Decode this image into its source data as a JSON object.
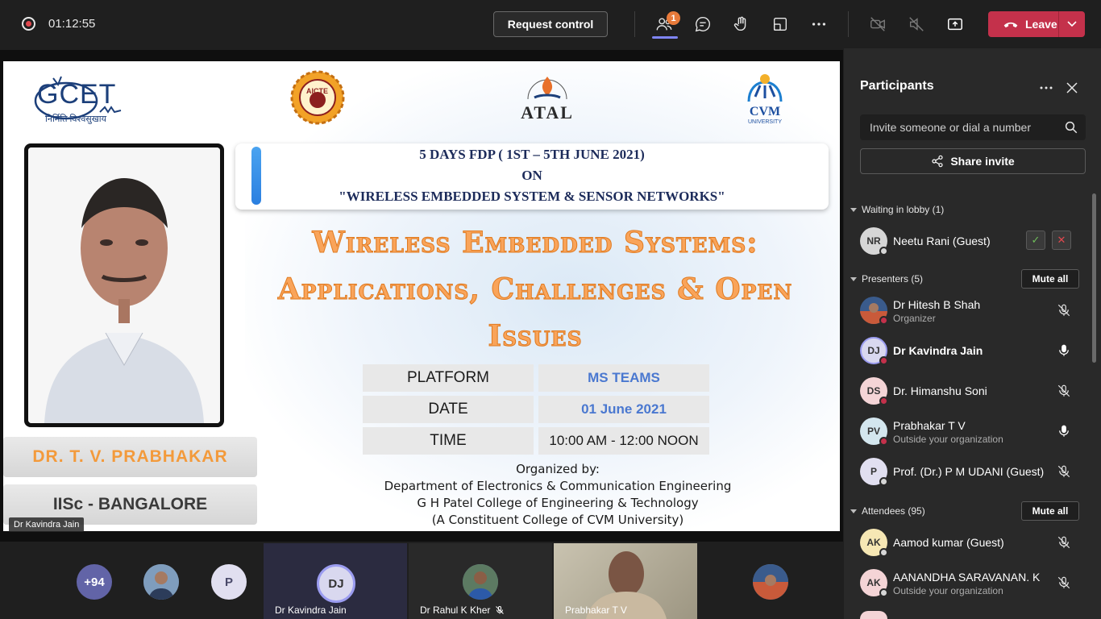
{
  "topbar": {
    "timer": "01:12:55",
    "request_control": "Request control",
    "participants_badge": "1",
    "leave_label": "Leave"
  },
  "slide": {
    "logos": {
      "gcet": "GCET",
      "gcet_tagline": "निर्मिति विश्वसुखाय",
      "aicte": "AICTE",
      "atal": "ATAL",
      "cvm": "CVM",
      "cvm_sub": "UNIVERSITY"
    },
    "fdp_line1": "5 DAYS FDP ( 1ST – 5TH JUNE 2021)",
    "fdp_line2": "ON",
    "fdp_line3": "\"WIRELESS EMBEDDED SYSTEM & SENSOR NETWORKS\"",
    "title_line1": "Wireless Embedded Systems:",
    "title_line2": "Applications, Challenges & Open",
    "title_line3": "Issues",
    "speaker_name": "DR. T. V. PRABHAKAR",
    "speaker_org": "IISc - BANGALORE",
    "info": [
      {
        "label": "PLATFORM",
        "value": "MS TEAMS"
      },
      {
        "label": "DATE",
        "value": "01 June 2021"
      },
      {
        "label": "TIME",
        "value": "10:00 AM - 12:00 NOON"
      }
    ],
    "organized_by": "Organized by:",
    "org_line1": "Department of Electronics & Communication Engineering",
    "org_line2": "G H Patel College of Engineering & Technology",
    "org_line3": "(A Constituent College of  CVM University)"
  },
  "stage_label": "Dr Kavindra Jain",
  "gallery": {
    "more_count": "+94",
    "p_initial": "P",
    "tiles": [
      {
        "initials": "DJ",
        "name": "Dr Kavindra Jain"
      },
      {
        "name": "Dr Rahul K Kher"
      },
      {
        "name": "Prabhakar T V"
      }
    ]
  },
  "panel": {
    "title": "Participants",
    "invite_placeholder": "Invite someone or dial a number",
    "share_invite": "Share invite",
    "lobby_head": "Waiting in lobby (1)",
    "lobby": [
      {
        "initials": "NR",
        "name": "Neetu Rani (Guest)"
      }
    ],
    "presenters_head": "Presenters (5)",
    "mute_all": "Mute all",
    "presenters": [
      {
        "initials": "",
        "name": "Dr Hitesh B Shah",
        "sub": "Organizer"
      },
      {
        "initials": "DJ",
        "name": "Dr Kavindra Jain",
        "sub": ""
      },
      {
        "initials": "DS",
        "name": "Dr. Himanshu Soni",
        "sub": ""
      },
      {
        "initials": "PV",
        "name": "Prabhakar T V",
        "sub": "Outside your organization"
      },
      {
        "initials": "P",
        "name": "Prof. (Dr.) P M UDANI (Guest)",
        "sub": ""
      }
    ],
    "attendees_head": "Attendees (95)",
    "attendees": [
      {
        "initials": "AK",
        "name": "Aamod kumar (Guest)",
        "sub": ""
      },
      {
        "initials": "AK",
        "name": "AANANDHA SARAVANAN. K",
        "sub": "Outside your organization"
      }
    ]
  }
}
